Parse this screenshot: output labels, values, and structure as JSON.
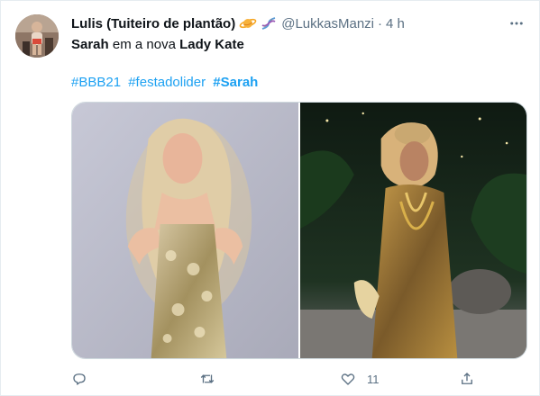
{
  "tweet": {
    "display_name": "Lulis (Tuiteiro de plantão)",
    "name_emojis": [
      "saturn-planet-emoji",
      "dna-emoji"
    ],
    "handle": "@LukkasManzi",
    "separator": "·",
    "time": "4 h",
    "more_icon": "ellipsis-icon",
    "text_name": "Sarah",
    "text_middle": " em a nova ",
    "text_end": "Lady Kate",
    "hashtags": [
      "#BBB21",
      "#festadolider",
      "#Sarah"
    ],
    "media": [
      {
        "label": "photo-left",
        "description_icon": "photo"
      },
      {
        "label": "photo-right",
        "description_icon": "photo"
      }
    ],
    "actions": {
      "reply_icon": "reply-icon",
      "retweet_icon": "retweet-icon",
      "like_icon": "heart-icon",
      "like_count": "11",
      "share_icon": "share-icon"
    },
    "colors": {
      "link": "#1da1f2",
      "muted": "#5b7083",
      "text": "#0f1419"
    }
  }
}
